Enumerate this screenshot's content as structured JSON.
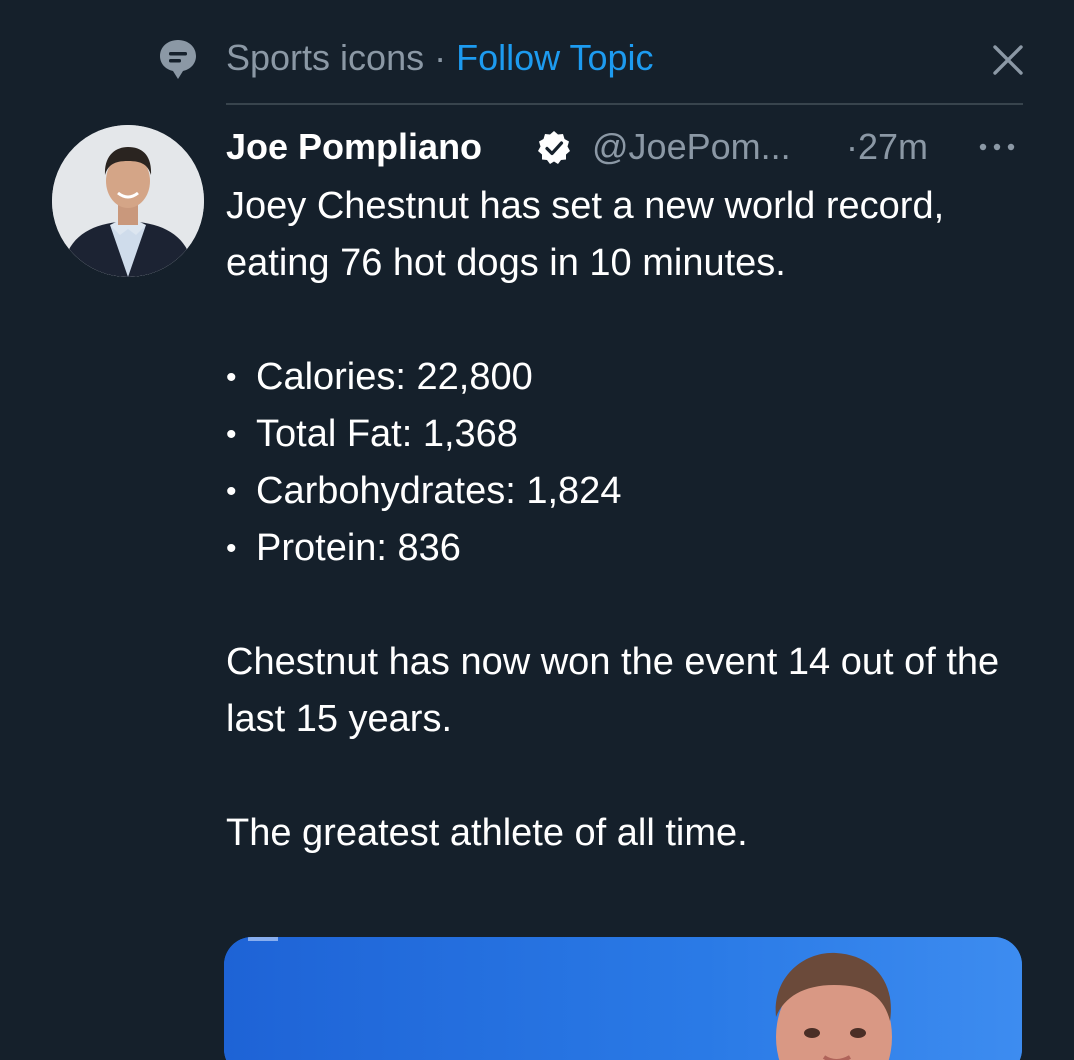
{
  "topic": {
    "icon": "topic-icon",
    "name": "Sports icons",
    "separator": " · ",
    "follow_label": "Follow Topic",
    "close_icon": "close-icon"
  },
  "tweet": {
    "author": {
      "display_name": "Joe Pompliano",
      "verified": true,
      "verified_icon": "verified-badge-icon",
      "handle": "@JoePom...",
      "avatar_icon": "profile-photo"
    },
    "timestamp": "·27m",
    "more_icon": "more-options-icon",
    "text": {
      "intro": "Joey Chestnut has set a new world record, eating 76 hot dogs in 10 minutes.",
      "stats": [
        "Calories: 22,800",
        "Total Fat: 1,368",
        "Carbohydrates: 1,824",
        "Protein: 836"
      ],
      "para2": "Chestnut has now won the event 14 out of the last 15 years.",
      "para3": "The greatest athlete of all time."
    },
    "media": {
      "type": "photo"
    }
  },
  "colors": {
    "background": "#15202b",
    "text_primary": "#ffffff",
    "text_secondary": "#8b98a5",
    "accent": "#1d9bf0",
    "divider": "#38444d",
    "media_sky": "#1f6fe0"
  }
}
